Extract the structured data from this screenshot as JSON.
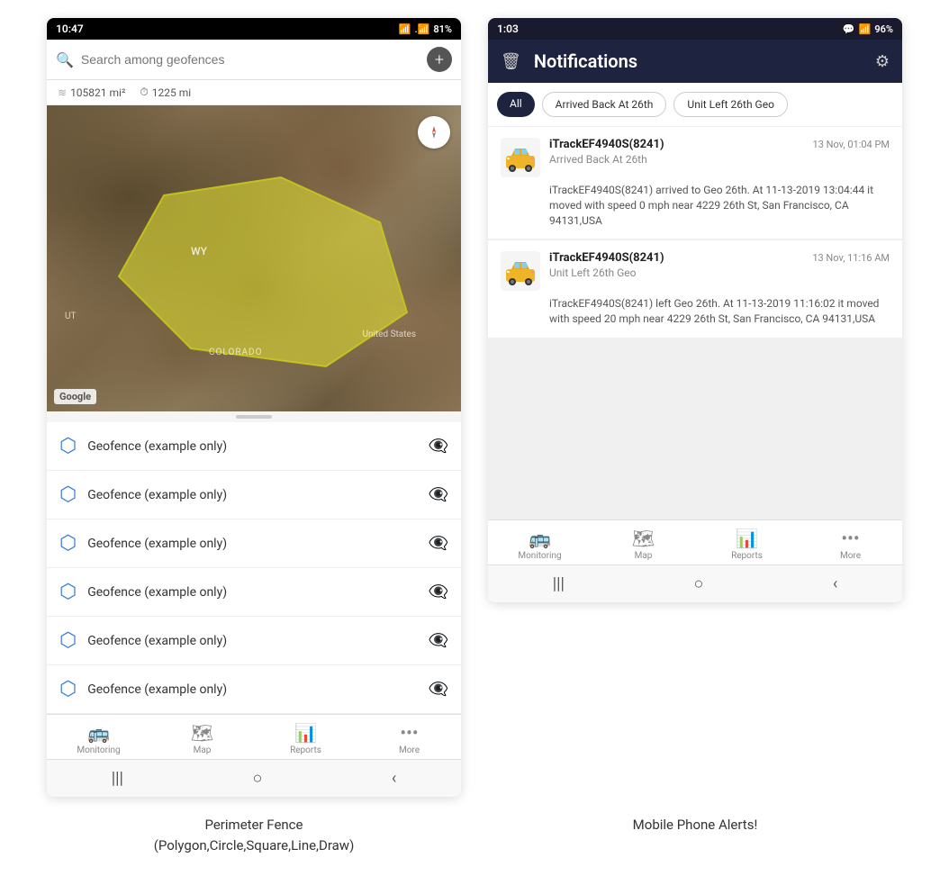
{
  "left_phone": {
    "status_bar": {
      "time": "10:47",
      "wifi": "WiFi",
      "signal": "81%",
      "battery": "81%"
    },
    "search": {
      "placeholder": "Search among geofences"
    },
    "stats": {
      "area": "105821 mi²",
      "distance": "1225 mi"
    },
    "map": {
      "label_wy": "WY",
      "label_colorado": "COLORADO",
      "label_us": "United States",
      "label_ut": "UT",
      "google": "Google"
    },
    "geofences": [
      {
        "name": "Geofence (example only)"
      },
      {
        "name": "Geofence (example only)"
      },
      {
        "name": "Geofence (example only)"
      },
      {
        "name": "Geofence (example only)"
      },
      {
        "name": "Geofence (example only)"
      },
      {
        "name": "Geofence (example only)"
      }
    ],
    "nav": [
      {
        "icon": "🚌",
        "label": "Monitoring"
      },
      {
        "icon": "🗺",
        "label": "Map"
      },
      {
        "icon": "📊",
        "label": "Reports"
      },
      {
        "icon": "···",
        "label": "More"
      }
    ],
    "android_nav": [
      "|||",
      "○",
      "<"
    ]
  },
  "right_phone": {
    "status_bar": {
      "time": "1:03",
      "chat": "💬",
      "wifi": "WiFi",
      "signal": "96%",
      "battery": "96%"
    },
    "header": {
      "title": "Notifications",
      "delete_icon": "🗑",
      "settings_icon": "⚙"
    },
    "filter_tabs": [
      {
        "label": "All",
        "active": true
      },
      {
        "label": "Arrived Back At 26th",
        "active": false
      },
      {
        "label": "Unit Left 26th Geo",
        "active": false
      }
    ],
    "notifications": [
      {
        "device": "iTrackEF4940S(8241)",
        "timestamp": "13 Nov, 01:04 PM",
        "event_type": "Arrived Back At 26th",
        "description": "iTrackEF4940S(8241) arrived to Geo 26th.    At 11-13-2019 13:04:44 it moved with speed 0 mph near 4229 26th St, San Francisco, CA 94131,USA"
      },
      {
        "device": "iTrackEF4940S(8241)",
        "timestamp": "13 Nov, 11:16 AM",
        "event_type": "Unit Left 26th Geo",
        "description": "iTrackEF4940S(8241) left Geo 26th.    At 11-13-2019 11:16:02 it moved with speed 20 mph near 4229 26th St, San Francisco, CA 94131,USA"
      }
    ],
    "nav": [
      {
        "icon": "🚌",
        "label": "Monitoring"
      },
      {
        "icon": "🗺",
        "label": "Map"
      },
      {
        "icon": "📊",
        "label": "Reports"
      },
      {
        "icon": "···",
        "label": "More"
      }
    ],
    "android_nav": [
      "|||",
      "○",
      "<"
    ]
  },
  "captions": {
    "left": "Perimeter Fence\n(Polygon,Circle,Square,Line,Draw)",
    "right": "Mobile Phone Alerts!"
  }
}
